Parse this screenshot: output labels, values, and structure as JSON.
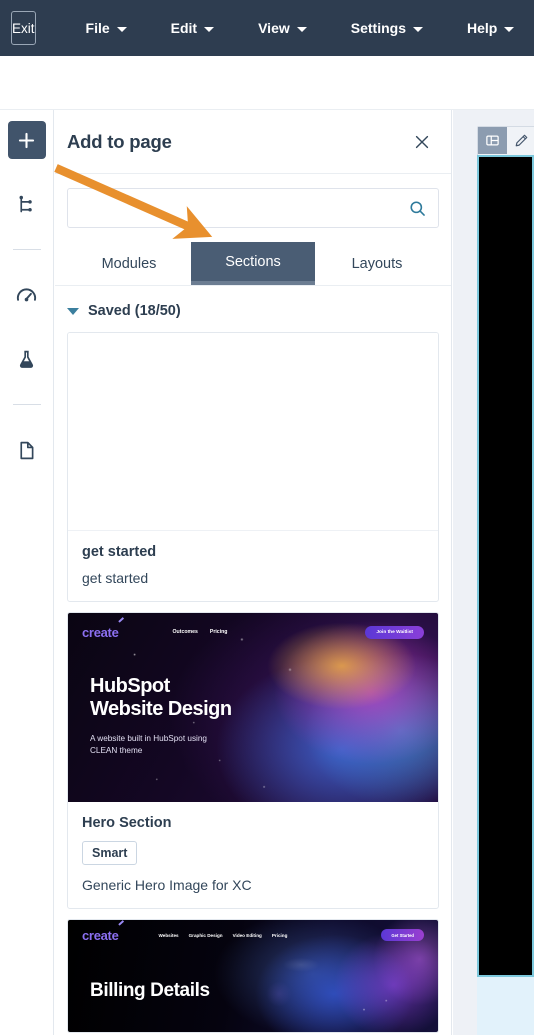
{
  "topbar": {
    "exit_label": "Exit",
    "menus": [
      {
        "label": "File",
        "icon": "chevron-down-icon"
      },
      {
        "label": "Edit",
        "icon": "chevron-down-icon"
      },
      {
        "label": "View",
        "icon": "chevron-down-icon"
      },
      {
        "label": "Settings",
        "icon": "chevron-down-icon"
      },
      {
        "label": "Help",
        "icon": "chevron-down-icon"
      }
    ],
    "background": "#2e3d50"
  },
  "rail": {
    "items": [
      {
        "icon": "plus-icon",
        "active": true
      },
      {
        "icon": "sitemap-icon",
        "active": false
      },
      {
        "icon": "speedometer-icon",
        "active": false
      },
      {
        "icon": "flask-icon",
        "active": false
      },
      {
        "icon": "document-icon",
        "active": false
      }
    ],
    "active_background": "#41546b"
  },
  "panel": {
    "title": "Add to page",
    "close_icon": "close-icon",
    "search": {
      "value": "",
      "placeholder": "",
      "icon": "search-icon",
      "icon_color": "#2e7a9b"
    },
    "tabs": [
      {
        "label": "Modules",
        "active": false
      },
      {
        "label": "Sections",
        "active": true
      },
      {
        "label": "Layouts",
        "active": false
      }
    ],
    "active_tab_background": "#4a5d74",
    "group": {
      "label": "Saved (18/50)",
      "expanded": true,
      "chevron_icon": "chevron-down-icon"
    },
    "cards": [
      {
        "thumb_type": "blank",
        "title": "get started",
        "badge": null,
        "description": "get started"
      },
      {
        "thumb_type": "hero-space",
        "title": "Hero Section",
        "badge": "Smart",
        "description": "Generic Hero Image for XC",
        "thumb": {
          "brand": "create",
          "nav_links": [
            "Outcomes",
            "Pricing"
          ],
          "cta": "Join the Waitlist",
          "heading_line1": "HubSpot",
          "heading_line2": "Website Design",
          "subtext_line1": "A website built in HubSpot using",
          "subtext_line2": "CLEAN theme"
        }
      },
      {
        "thumb_type": "hero-billing",
        "title": null,
        "badge": null,
        "description": null,
        "thumb": {
          "brand": "create",
          "nav_links": [
            "Websites",
            "Graphic Design",
            "Video Editing",
            "Pricing"
          ],
          "cta": "Get Started",
          "heading_line1": "Billing Details"
        }
      }
    ]
  },
  "preview": {
    "toolbar": [
      {
        "icon": "panel-layout-icon",
        "active": true
      },
      {
        "icon": "pencil-icon",
        "active": false
      }
    ],
    "border_color": "#7cc8dc",
    "canvas_color": "#000000"
  },
  "annotation": {
    "arrow_color": "#e8902e",
    "points_to": "Sections"
  }
}
